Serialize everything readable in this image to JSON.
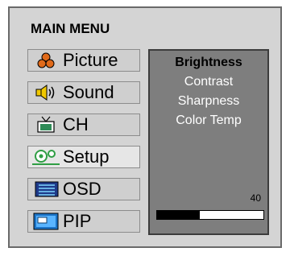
{
  "menu_title": "MAIN MENU",
  "menu_items": [
    {
      "label": "Picture",
      "icon": "picture-icon"
    },
    {
      "label": "Sound",
      "icon": "sound-icon"
    },
    {
      "label": "CH",
      "icon": "tv-icon"
    },
    {
      "label": "Setup",
      "icon": "setup-icon"
    },
    {
      "label": "OSD",
      "icon": "osd-icon"
    },
    {
      "label": "PIP",
      "icon": "pip-icon"
    }
  ],
  "selected_menu_item": "Setup",
  "submenu": {
    "items": [
      "Brightness",
      "Contrast",
      "Sharpness",
      "Color Temp"
    ],
    "active_item": "Brightness",
    "value_label": "40",
    "level": 0.4
  },
  "colors": {
    "frame_bg": "#d4d4d4",
    "panel_bg": "#7e7e7e",
    "bar_fill": "#000000",
    "picture_icon": "#e06a1a",
    "sound_icon": "#f0c800",
    "tv_icon": "#2e8b57",
    "setup_icon": "#2f9e44",
    "osd_icon": "#1e3a8a",
    "pip_icon": "#1b74c8"
  }
}
